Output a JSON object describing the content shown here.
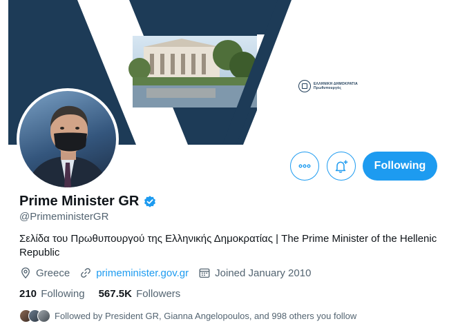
{
  "banner": {
    "logo_line1": "ΕΛΛΗΝΙΚΗ ΔΗΜΟΚΡΑΤΙΑ",
    "logo_line2": "Πρωθυπουργός"
  },
  "actions": {
    "following_label": "Following"
  },
  "profile": {
    "name": "Prime Minister GR",
    "handle": "@PrimeministerGR",
    "bio": "Σελίδα του Πρωθυπουργού της Ελληνικής Δημοκρατίας | The Prime Minister of the Hellenic Republic",
    "location": "Greece",
    "website": "primeminister.gov.gr",
    "joined": "Joined January 2010"
  },
  "stats": {
    "following_count": "210",
    "following_label": "Following",
    "followers_count": "567.5K",
    "followers_label": "Followers"
  },
  "followed_by": {
    "text": "Followed by President GR, Gianna Angelopoulos, and 998 others you follow"
  },
  "colors": {
    "accent": "#1d9bf0",
    "banner_navy": "#1d3b57",
    "muted_text": "#536471"
  }
}
